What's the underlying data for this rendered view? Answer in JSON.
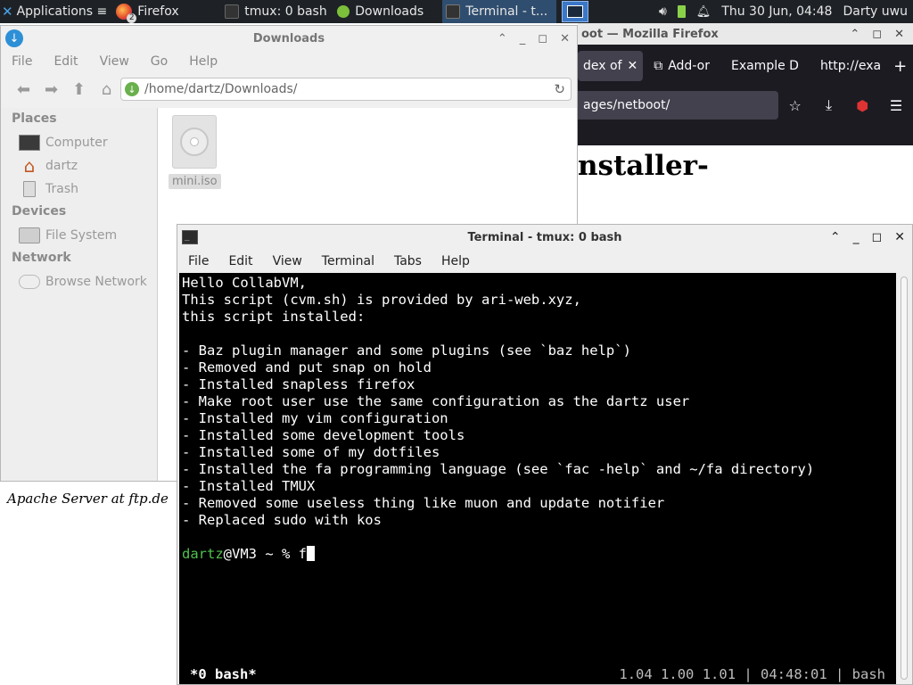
{
  "panel": {
    "apps_label": "Applications ≡",
    "tasks": [
      {
        "label": "Firefox",
        "badge": "2"
      },
      {
        "label": "tmux: 0 bash"
      },
      {
        "label": "Downloads"
      },
      {
        "label": "Terminal - t..."
      }
    ],
    "clock": "Thu 30 Jun, 04:48",
    "user": "Darty uwu"
  },
  "firefox": {
    "title": "oot — Mozilla Firefox",
    "tabs": [
      "dex of",
      "Add-or",
      "Example D",
      "http://exa"
    ],
    "url": "ages/netboot/",
    "page_heading": "nstaller-",
    "footer": "Apache Server at ftp.de"
  },
  "filemanager": {
    "title": "Downloads",
    "menu": [
      "File",
      "Edit",
      "View",
      "Go",
      "Help"
    ],
    "location": "/home/dartz/Downloads/",
    "places_header": "Places",
    "places": [
      "Computer",
      "dartz",
      "Trash"
    ],
    "devices_header": "Devices",
    "devices": [
      "File System"
    ],
    "network_header": "Network",
    "network": [
      "Browse Network"
    ],
    "file_name": "mini.iso"
  },
  "terminal": {
    "title": "Terminal - tmux: 0 bash",
    "menu": [
      "File",
      "Edit",
      "View",
      "Terminal",
      "Tabs",
      "Help"
    ],
    "lines": [
      "Hello CollabVM,",
      "This script (cvm.sh) is provided by ari-web.xyz,",
      "this script installed:",
      "",
      "- Baz plugin manager and some plugins (see `baz help`)",
      "- Removed and put snap on hold",
      "- Installed snapless firefox",
      "- Make root user use the same configuration as the dartz user",
      "- Installed my vim configuration",
      "- Installed some development tools",
      "- Installed some of my dotfiles",
      "- Installed the fa programming language (see `fac -help` and ~/fa directory)",
      "- Installed TMUX",
      "- Removed some useless thing like muon and update notifier",
      "- Replaced sudo with kos",
      ""
    ],
    "prompt_user": "dartz",
    "prompt_rest": "@VM3 ~ % ",
    "typed": "f",
    "tmux_left": "*0 bash*",
    "tmux_right": "1.04 1.00 1.01 | 04:48:01 | bash"
  }
}
